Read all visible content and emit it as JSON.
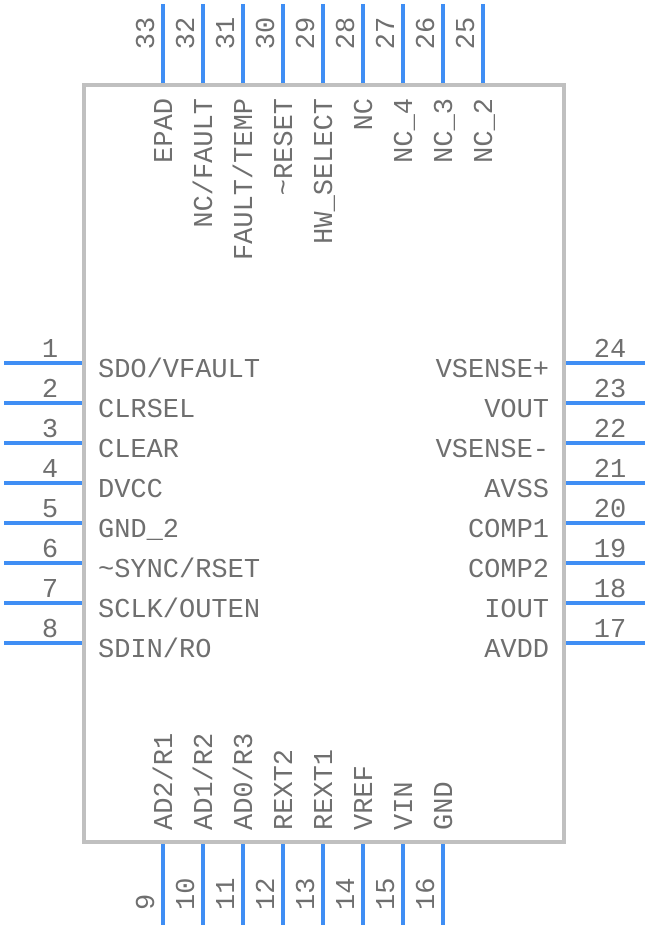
{
  "colors": {
    "body_outline": "#c0c0c0",
    "pin_line": "#3f8ef4",
    "text": "#6f6f6f",
    "background": "#ffffff"
  },
  "component": {
    "pins_left": [
      {
        "number": "1",
        "name": "SDO/VFAULT"
      },
      {
        "number": "2",
        "name": "CLRSEL"
      },
      {
        "number": "3",
        "name": "CLEAR"
      },
      {
        "number": "4",
        "name": "DVCC"
      },
      {
        "number": "5",
        "name": "GND_2"
      },
      {
        "number": "6",
        "name": "~SYNC/RSET"
      },
      {
        "number": "7",
        "name": "SCLK/OUTEN"
      },
      {
        "number": "8",
        "name": "SDIN/RO"
      }
    ],
    "pins_bottom": [
      {
        "number": "9",
        "name": "AD2/R1"
      },
      {
        "number": "10",
        "name": "AD1/R2"
      },
      {
        "number": "11",
        "name": "AD0/R3"
      },
      {
        "number": "12",
        "name": "REXT2"
      },
      {
        "number": "13",
        "name": "REXT1"
      },
      {
        "number": "14",
        "name": "VREF"
      },
      {
        "number": "15",
        "name": "VIN"
      },
      {
        "number": "16",
        "name": "GND"
      }
    ],
    "pins_right": [
      {
        "number": "17",
        "name": "AVDD"
      },
      {
        "number": "18",
        "name": "IOUT"
      },
      {
        "number": "19",
        "name": "COMP2"
      },
      {
        "number": "20",
        "name": "COMP1"
      },
      {
        "number": "21",
        "name": "AVSS"
      },
      {
        "number": "22",
        "name": "VSENSE-"
      },
      {
        "number": "23",
        "name": "VOUT"
      },
      {
        "number": "24",
        "name": "VSENSE+"
      }
    ],
    "pins_top": [
      {
        "number": "25",
        "name": "NC_2"
      },
      {
        "number": "26",
        "name": "NC_3"
      },
      {
        "number": "27",
        "name": "NC_4"
      },
      {
        "number": "28",
        "name": "NC"
      },
      {
        "number": "29",
        "name": "HW_SELECT"
      },
      {
        "number": "30",
        "name": "~RESET"
      },
      {
        "number": "31",
        "name": "FAULT/TEMP"
      },
      {
        "number": "32",
        "name": "NC/FAULT"
      },
      {
        "number": "33",
        "name": "EPAD"
      }
    ]
  }
}
